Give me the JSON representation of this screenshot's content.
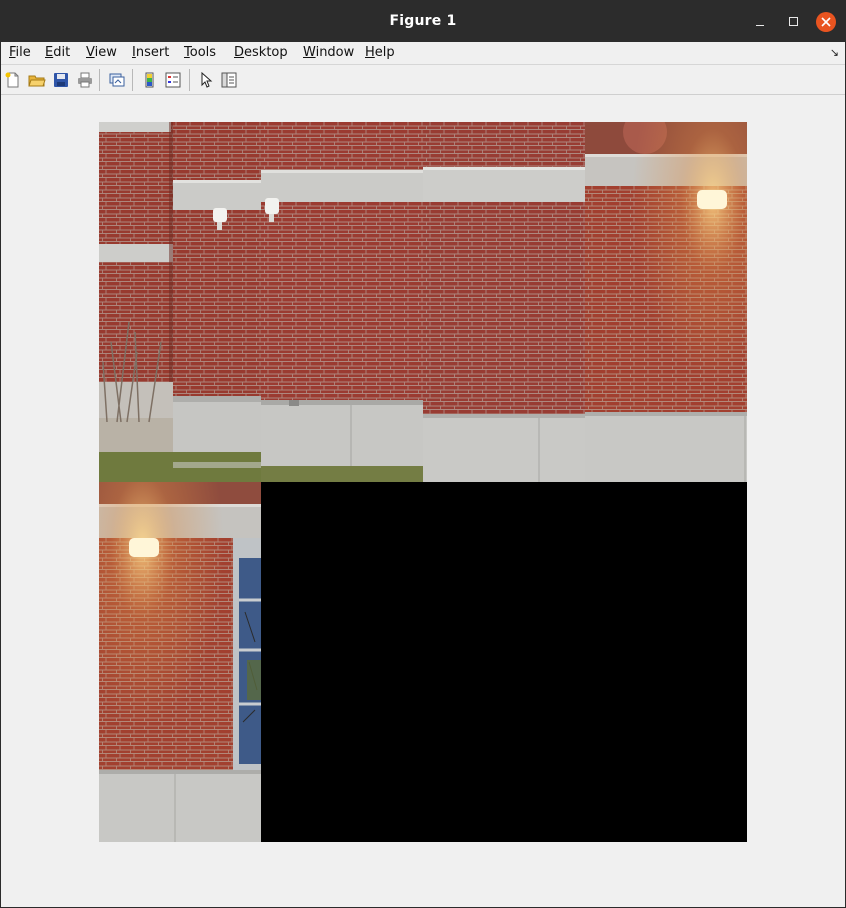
{
  "window": {
    "title": "Figure 1"
  },
  "menu": {
    "items": [
      {
        "key": "F",
        "rest": "ile"
      },
      {
        "key": "E",
        "rest": "dit"
      },
      {
        "key": "V",
        "rest": "iew"
      },
      {
        "key": "I",
        "rest": "nsert"
      },
      {
        "key": "T",
        "rest": "ools"
      },
      {
        "key": "D",
        "rest": "esktop"
      },
      {
        "key": "W",
        "rest": "indow"
      },
      {
        "key": "H",
        "rest": "elp"
      }
    ]
  },
  "toolbar": {
    "icons": [
      "new-figure-icon",
      "open-file-icon",
      "save-icon",
      "print-icon",
      "link-figure-icon",
      "insert-colorbar-icon",
      "insert-legend-icon",
      "edit-plot-icon",
      "property-inspector-icon"
    ]
  },
  "montage": {
    "grid": "5x2",
    "tiles_filled": 6,
    "empty_fill": "#000000",
    "colors": {
      "brick": "#9a3a30",
      "concrete": "#c9c9c7",
      "grass": "#6f7a3e",
      "light": "#fff3c8"
    }
  }
}
